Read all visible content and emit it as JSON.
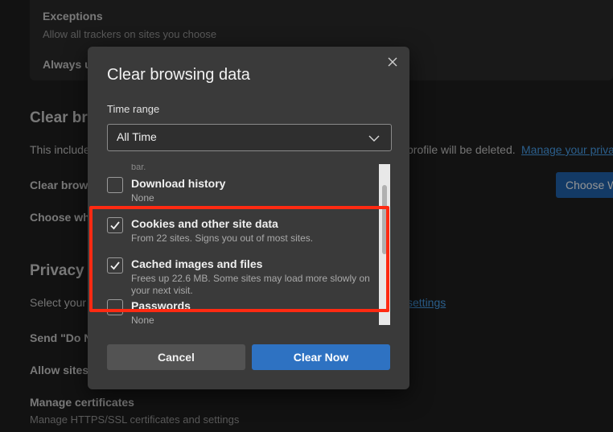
{
  "background": {
    "exceptions_title": "Exceptions",
    "exceptions_desc": "Allow all trackers on sites you choose",
    "always_label": "Always u",
    "clear_heading": "Clear br",
    "clear_desc_left": "This include",
    "clear_desc_right": "profile will be deleted.",
    "manage_link": "Manage your priva",
    "clear_row": "Clear brow",
    "choose_row": "Choose wh",
    "choose_button": "Choose W",
    "privacy_heading": "Privacy",
    "select_row": "Select your",
    "settings_link": "settings",
    "send_dnt": "Send \"Do N",
    "allow_sites": "Allow sites",
    "manage_certs_title": "Manage certificates",
    "manage_certs_desc": "Manage HTTPS/SSL certificates and settings"
  },
  "dialog": {
    "title": "Clear browsing data",
    "close_icon": "close-icon",
    "time_range_label": "Time range",
    "time_range_value": "All Time",
    "cut_text": "bar.",
    "items": [
      {
        "title": "Download history",
        "subtitle": "None",
        "checked": false
      },
      {
        "title": "Cookies and other site data",
        "subtitle": "From 22 sites. Signs you out of most sites.",
        "checked": true
      },
      {
        "title": "Cached images and files",
        "subtitle": "Frees up 22.6 MB. Some sites may load more slowly on your next visit.",
        "checked": true
      },
      {
        "title": "Passwords",
        "subtitle": "None",
        "checked": false
      }
    ],
    "cancel_label": "Cancel",
    "clear_label": "Clear Now"
  },
  "colors": {
    "accent": "#2e72c2",
    "highlight": "#ff2a12"
  }
}
